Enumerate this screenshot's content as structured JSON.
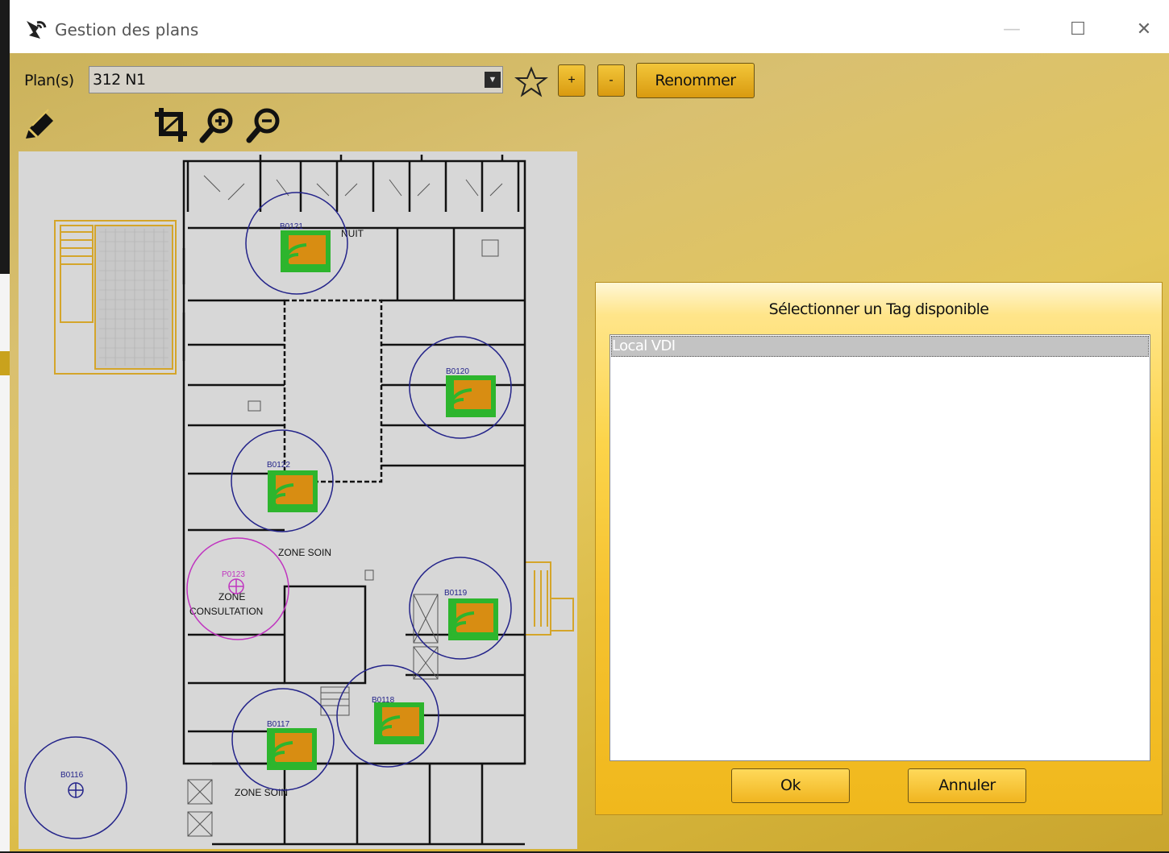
{
  "window": {
    "title": "Gestion des plans",
    "minimize_icon": "—",
    "maximize_icon": "☐",
    "close_icon": "✕"
  },
  "toolbar": {
    "plan_label": "Plan(s)",
    "plan_selected": "312 N1",
    "dropdown_arrow": "▼",
    "add_label": "+",
    "remove_label": "-",
    "rename_label": "Renommer"
  },
  "map": {
    "tags": [
      "B0121",
      "B0120",
      "B0122",
      "P0123",
      "B0119",
      "B0117",
      "B0118",
      "B0116"
    ],
    "zones": [
      "NUIT",
      "ZONE SOIN",
      "ZONE",
      "CONSULTATION",
      "ZONE SOIN"
    ]
  },
  "dialog": {
    "title": "Sélectionner un Tag disponible",
    "items": [
      "Local VDI"
    ],
    "ok_label": "Ok",
    "cancel_label": "Annuler"
  },
  "colors": {
    "accent": "#f0b81c",
    "wifi_green": "#2db52d",
    "wifi_orange": "#d88d12",
    "circle_blue": "#24248a",
    "circle_magenta": "#c035c0"
  }
}
